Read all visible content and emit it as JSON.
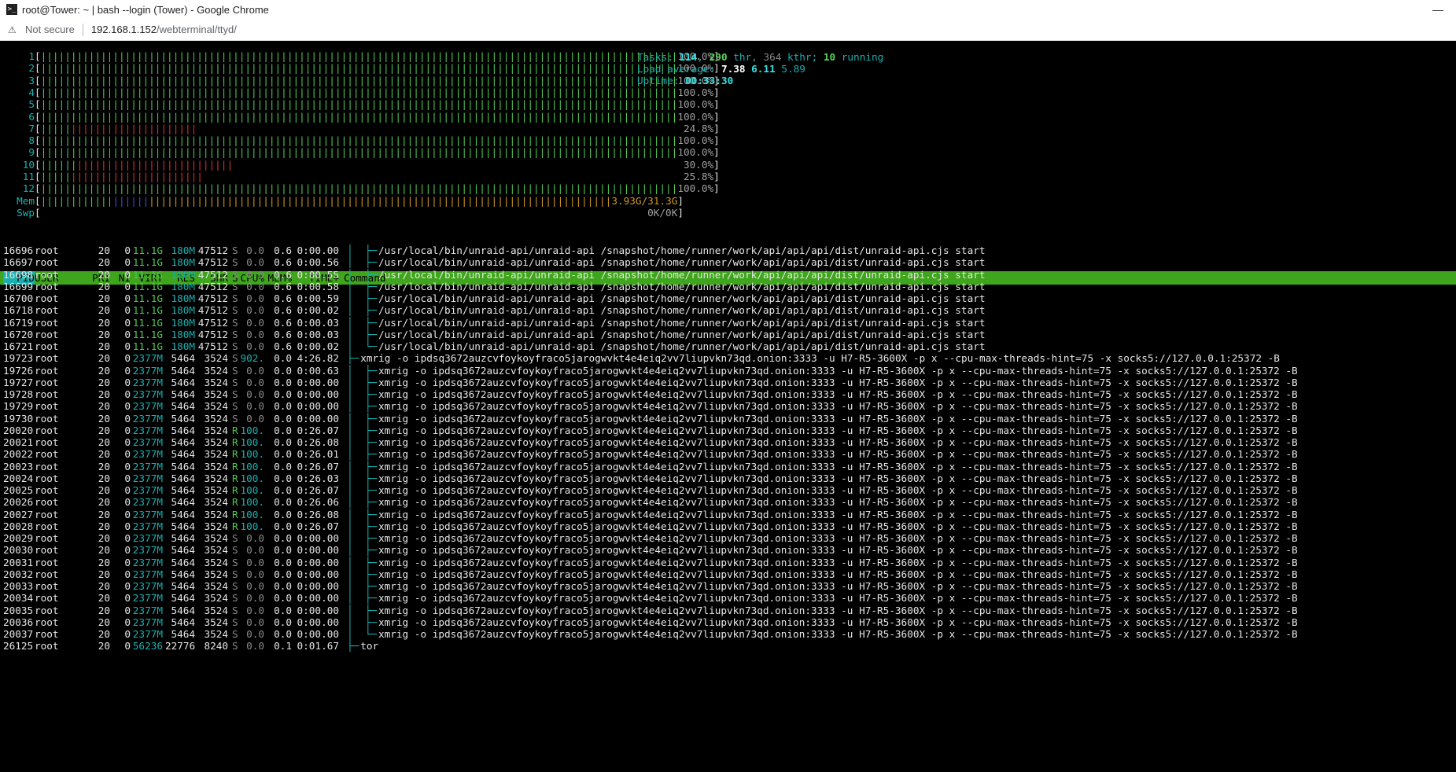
{
  "window": {
    "title": "root@Tower: ~ | bash --login (Tower) - Google Chrome",
    "minimize": "—"
  },
  "address": {
    "security": "Not secure",
    "host": "192.168.1.152",
    "path": "/webterminal/ttyd/"
  },
  "meters": {
    "cpus": [
      {
        "label": "1",
        "value": "100.0%",
        "level": 1.0,
        "red": false
      },
      {
        "label": "2",
        "value": "100.0%",
        "level": 1.0,
        "red": false
      },
      {
        "label": "3",
        "value": "100.0%",
        "level": 1.0,
        "red": false
      },
      {
        "label": "4",
        "value": "100.0%",
        "level": 1.0,
        "red": false
      },
      {
        "label": "5",
        "value": "100.0%",
        "level": 1.0,
        "red": false
      },
      {
        "label": "6",
        "value": "100.0%",
        "level": 1.0,
        "red": false
      },
      {
        "label": "7",
        "value": "24.8%",
        "level": 0.248,
        "red": true
      },
      {
        "label": "8",
        "value": "100.0%",
        "level": 1.0,
        "red": false
      },
      {
        "label": "9",
        "value": "100.0%",
        "level": 1.0,
        "red": false
      },
      {
        "label": "10",
        "value": "30.0%",
        "level": 0.3,
        "red": true
      },
      {
        "label": "11",
        "value": "25.8%",
        "level": 0.258,
        "red": true
      },
      {
        "label": "12",
        "value": "100.0%",
        "level": 1.0,
        "red": false
      }
    ],
    "mem": {
      "label": "Mem",
      "value": "3.93G/31.3G"
    },
    "swp": {
      "label": "Swp",
      "value": "0K/0K"
    }
  },
  "summary": {
    "tasks_label": "Tasks:",
    "tasks": "114",
    "thr": "290",
    "thr_label": "thr,",
    "kthr": "364",
    "kthr_label": "kthr;",
    "running": "10",
    "running_label": "running",
    "load_label": "Load average:",
    "load1": "7.38",
    "load5": "6.11",
    "load15": "5.89",
    "uptime_label": "Uptime:",
    "uptime": "00:33:30"
  },
  "columns": [
    "PID",
    "USER",
    "PRI",
    "NI",
    "VIRT",
    "RES",
    "SHR",
    "S",
    "CPU%",
    "MEM%",
    "TIME+",
    "Command"
  ],
  "processes": [
    {
      "pid": "16696",
      "user": "root",
      "pri": "20",
      "ni": "0",
      "virt": "11.1G",
      "res": "180M",
      "shr": "47512",
      "s": "S",
      "cpu": "0.0",
      "mem": "0.6",
      "time": "0:00.00",
      "tree": "│  ├─",
      "cmd": "/usr/local/bin/unraid-api/unraid-api /snapshot/home/runner/work/api/api/api/dist/unraid-api.cjs start"
    },
    {
      "pid": "16697",
      "user": "root",
      "pri": "20",
      "ni": "0",
      "virt": "11.1G",
      "res": "180M",
      "shr": "47512",
      "s": "S",
      "cpu": "0.0",
      "mem": "0.6",
      "time": "0:00.56",
      "tree": "│  ├─",
      "cmd": "/usr/local/bin/unraid-api/unraid-api /snapshot/home/runner/work/api/api/api/dist/unraid-api.cjs start"
    },
    {
      "pid": "16698",
      "user": "root",
      "pri": "20",
      "ni": "0",
      "virt": "11.1G",
      "res": "180M",
      "shr": "47512",
      "s": "S",
      "cpu": "0.0",
      "mem": "0.6",
      "time": "0:00.55",
      "tree": "│  ├─",
      "cmd": "/usr/local/bin/unraid-api/unraid-api /snapshot/home/runner/work/api/api/api/dist/unraid-api.cjs start"
    },
    {
      "pid": "16699",
      "user": "root",
      "pri": "20",
      "ni": "0",
      "virt": "11.1G",
      "res": "180M",
      "shr": "47512",
      "s": "S",
      "cpu": "0.0",
      "mem": "0.6",
      "time": "0:00.58",
      "tree": "│  ├─",
      "cmd": "/usr/local/bin/unraid-api/unraid-api /snapshot/home/runner/work/api/api/api/dist/unraid-api.cjs start"
    },
    {
      "pid": "16700",
      "user": "root",
      "pri": "20",
      "ni": "0",
      "virt": "11.1G",
      "res": "180M",
      "shr": "47512",
      "s": "S",
      "cpu": "0.0",
      "mem": "0.6",
      "time": "0:00.59",
      "tree": "│  ├─",
      "cmd": "/usr/local/bin/unraid-api/unraid-api /snapshot/home/runner/work/api/api/api/dist/unraid-api.cjs start"
    },
    {
      "pid": "16718",
      "user": "root",
      "pri": "20",
      "ni": "0",
      "virt": "11.1G",
      "res": "180M",
      "shr": "47512",
      "s": "S",
      "cpu": "0.0",
      "mem": "0.6",
      "time": "0:00.02",
      "tree": "│  ├─",
      "cmd": "/usr/local/bin/unraid-api/unraid-api /snapshot/home/runner/work/api/api/api/dist/unraid-api.cjs start"
    },
    {
      "pid": "16719",
      "user": "root",
      "pri": "20",
      "ni": "0",
      "virt": "11.1G",
      "res": "180M",
      "shr": "47512",
      "s": "S",
      "cpu": "0.0",
      "mem": "0.6",
      "time": "0:00.03",
      "tree": "│  ├─",
      "cmd": "/usr/local/bin/unraid-api/unraid-api /snapshot/home/runner/work/api/api/api/dist/unraid-api.cjs start"
    },
    {
      "pid": "16720",
      "user": "root",
      "pri": "20",
      "ni": "0",
      "virt": "11.1G",
      "res": "180M",
      "shr": "47512",
      "s": "S",
      "cpu": "0.0",
      "mem": "0.6",
      "time": "0:00.03",
      "tree": "│  ├─",
      "cmd": "/usr/local/bin/unraid-api/unraid-api /snapshot/home/runner/work/api/api/api/dist/unraid-api.cjs start"
    },
    {
      "pid": "16721",
      "user": "root",
      "pri": "20",
      "ni": "0",
      "virt": "11.1G",
      "res": "180M",
      "shr": "47512",
      "s": "S",
      "cpu": "0.0",
      "mem": "0.6",
      "time": "0:00.02",
      "tree": "│  └─",
      "cmd": "/usr/local/bin/unraid-api/unraid-api /snapshot/home/runner/work/api/api/api/dist/unraid-api.cjs start"
    },
    {
      "pid": "19723",
      "user": "root",
      "pri": "20",
      "ni": "0",
      "virt": "2377M",
      "res": "5464",
      "shr": "3524",
      "s": "S",
      "cpu": "902.",
      "mem": "0.0",
      "time": "4:26.82",
      "tree": "├─",
      "cmd": "xmrig -o ipdsq3672auzcvfoykoyfraco5jarogwvkt4e4eiq2vv7liupvkn73qd.onion:3333 -u H7-R5-3600X -p x --cpu-max-threads-hint=75 -x socks5://127.0.0.1:25372 -B"
    },
    {
      "pid": "19726",
      "user": "root",
      "pri": "20",
      "ni": "0",
      "virt": "2377M",
      "res": "5464",
      "shr": "3524",
      "s": "S",
      "cpu": "0.0",
      "mem": "0.0",
      "time": "0:00.63",
      "tree": "│  ├─",
      "cmd": "xmrig -o ipdsq3672auzcvfoykoyfraco5jarogwvkt4e4eiq2vv7liupvkn73qd.onion:3333 -u H7-R5-3600X -p x --cpu-max-threads-hint=75 -x socks5://127.0.0.1:25372 -B"
    },
    {
      "pid": "19727",
      "user": "root",
      "pri": "20",
      "ni": "0",
      "virt": "2377M",
      "res": "5464",
      "shr": "3524",
      "s": "S",
      "cpu": "0.0",
      "mem": "0.0",
      "time": "0:00.00",
      "tree": "│  ├─",
      "cmd": "xmrig -o ipdsq3672auzcvfoykoyfraco5jarogwvkt4e4eiq2vv7liupvkn73qd.onion:3333 -u H7-R5-3600X -p x --cpu-max-threads-hint=75 -x socks5://127.0.0.1:25372 -B"
    },
    {
      "pid": "19728",
      "user": "root",
      "pri": "20",
      "ni": "0",
      "virt": "2377M",
      "res": "5464",
      "shr": "3524",
      "s": "S",
      "cpu": "0.0",
      "mem": "0.0",
      "time": "0:00.00",
      "tree": "│  ├─",
      "cmd": "xmrig -o ipdsq3672auzcvfoykoyfraco5jarogwvkt4e4eiq2vv7liupvkn73qd.onion:3333 -u H7-R5-3600X -p x --cpu-max-threads-hint=75 -x socks5://127.0.0.1:25372 -B"
    },
    {
      "pid": "19729",
      "user": "root",
      "pri": "20",
      "ni": "0",
      "virt": "2377M",
      "res": "5464",
      "shr": "3524",
      "s": "S",
      "cpu": "0.0",
      "mem": "0.0",
      "time": "0:00.00",
      "tree": "│  ├─",
      "cmd": "xmrig -o ipdsq3672auzcvfoykoyfraco5jarogwvkt4e4eiq2vv7liupvkn73qd.onion:3333 -u H7-R5-3600X -p x --cpu-max-threads-hint=75 -x socks5://127.0.0.1:25372 -B"
    },
    {
      "pid": "19730",
      "user": "root",
      "pri": "20",
      "ni": "0",
      "virt": "2377M",
      "res": "5464",
      "shr": "3524",
      "s": "S",
      "cpu": "0.0",
      "mem": "0.0",
      "time": "0:00.00",
      "tree": "│  ├─",
      "cmd": "xmrig -o ipdsq3672auzcvfoykoyfraco5jarogwvkt4e4eiq2vv7liupvkn73qd.onion:3333 -u H7-R5-3600X -p x --cpu-max-threads-hint=75 -x socks5://127.0.0.1:25372 -B"
    },
    {
      "pid": "20020",
      "user": "root",
      "pri": "20",
      "ni": "0",
      "virt": "2377M",
      "res": "5464",
      "shr": "3524",
      "s": "R",
      "cpu": "100.",
      "mem": "0.0",
      "time": "0:26.07",
      "tree": "│  ├─",
      "cmd": "xmrig -o ipdsq3672auzcvfoykoyfraco5jarogwvkt4e4eiq2vv7liupvkn73qd.onion:3333 -u H7-R5-3600X -p x --cpu-max-threads-hint=75 -x socks5://127.0.0.1:25372 -B"
    },
    {
      "pid": "20021",
      "user": "root",
      "pri": "20",
      "ni": "0",
      "virt": "2377M",
      "res": "5464",
      "shr": "3524",
      "s": "R",
      "cpu": "100.",
      "mem": "0.0",
      "time": "0:26.08",
      "tree": "│  ├─",
      "cmd": "xmrig -o ipdsq3672auzcvfoykoyfraco5jarogwvkt4e4eiq2vv7liupvkn73qd.onion:3333 -u H7-R5-3600X -p x --cpu-max-threads-hint=75 -x socks5://127.0.0.1:25372 -B"
    },
    {
      "pid": "20022",
      "user": "root",
      "pri": "20",
      "ni": "0",
      "virt": "2377M",
      "res": "5464",
      "shr": "3524",
      "s": "R",
      "cpu": "100.",
      "mem": "0.0",
      "time": "0:26.01",
      "tree": "│  ├─",
      "cmd": "xmrig -o ipdsq3672auzcvfoykoyfraco5jarogwvkt4e4eiq2vv7liupvkn73qd.onion:3333 -u H7-R5-3600X -p x --cpu-max-threads-hint=75 -x socks5://127.0.0.1:25372 -B"
    },
    {
      "pid": "20023",
      "user": "root",
      "pri": "20",
      "ni": "0",
      "virt": "2377M",
      "res": "5464",
      "shr": "3524",
      "s": "R",
      "cpu": "100.",
      "mem": "0.0",
      "time": "0:26.07",
      "tree": "│  ├─",
      "cmd": "xmrig -o ipdsq3672auzcvfoykoyfraco5jarogwvkt4e4eiq2vv7liupvkn73qd.onion:3333 -u H7-R5-3600X -p x --cpu-max-threads-hint=75 -x socks5://127.0.0.1:25372 -B"
    },
    {
      "pid": "20024",
      "user": "root",
      "pri": "20",
      "ni": "0",
      "virt": "2377M",
      "res": "5464",
      "shr": "3524",
      "s": "R",
      "cpu": "100.",
      "mem": "0.0",
      "time": "0:26.03",
      "tree": "│  ├─",
      "cmd": "xmrig -o ipdsq3672auzcvfoykoyfraco5jarogwvkt4e4eiq2vv7liupvkn73qd.onion:3333 -u H7-R5-3600X -p x --cpu-max-threads-hint=75 -x socks5://127.0.0.1:25372 -B"
    },
    {
      "pid": "20025",
      "user": "root",
      "pri": "20",
      "ni": "0",
      "virt": "2377M",
      "res": "5464",
      "shr": "3524",
      "s": "R",
      "cpu": "100.",
      "mem": "0.0",
      "time": "0:26.07",
      "tree": "│  ├─",
      "cmd": "xmrig -o ipdsq3672auzcvfoykoyfraco5jarogwvkt4e4eiq2vv7liupvkn73qd.onion:3333 -u H7-R5-3600X -p x --cpu-max-threads-hint=75 -x socks5://127.0.0.1:25372 -B"
    },
    {
      "pid": "20026",
      "user": "root",
      "pri": "20",
      "ni": "0",
      "virt": "2377M",
      "res": "5464",
      "shr": "3524",
      "s": "R",
      "cpu": "100.",
      "mem": "0.0",
      "time": "0:26.06",
      "tree": "│  ├─",
      "cmd": "xmrig -o ipdsq3672auzcvfoykoyfraco5jarogwvkt4e4eiq2vv7liupvkn73qd.onion:3333 -u H7-R5-3600X -p x --cpu-max-threads-hint=75 -x socks5://127.0.0.1:25372 -B"
    },
    {
      "pid": "20027",
      "user": "root",
      "pri": "20",
      "ni": "0",
      "virt": "2377M",
      "res": "5464",
      "shr": "3524",
      "s": "R",
      "cpu": "100.",
      "mem": "0.0",
      "time": "0:26.08",
      "tree": "│  ├─",
      "cmd": "xmrig -o ipdsq3672auzcvfoykoyfraco5jarogwvkt4e4eiq2vv7liupvkn73qd.onion:3333 -u H7-R5-3600X -p x --cpu-max-threads-hint=75 -x socks5://127.0.0.1:25372 -B"
    },
    {
      "pid": "20028",
      "user": "root",
      "pri": "20",
      "ni": "0",
      "virt": "2377M",
      "res": "5464",
      "shr": "3524",
      "s": "R",
      "cpu": "100.",
      "mem": "0.0",
      "time": "0:26.07",
      "tree": "│  ├─",
      "cmd": "xmrig -o ipdsq3672auzcvfoykoyfraco5jarogwvkt4e4eiq2vv7liupvkn73qd.onion:3333 -u H7-R5-3600X -p x --cpu-max-threads-hint=75 -x socks5://127.0.0.1:25372 -B"
    },
    {
      "pid": "20029",
      "user": "root",
      "pri": "20",
      "ni": "0",
      "virt": "2377M",
      "res": "5464",
      "shr": "3524",
      "s": "S",
      "cpu": "0.0",
      "mem": "0.0",
      "time": "0:00.00",
      "tree": "│  ├─",
      "cmd": "xmrig -o ipdsq3672auzcvfoykoyfraco5jarogwvkt4e4eiq2vv7liupvkn73qd.onion:3333 -u H7-R5-3600X -p x --cpu-max-threads-hint=75 -x socks5://127.0.0.1:25372 -B"
    },
    {
      "pid": "20030",
      "user": "root",
      "pri": "20",
      "ni": "0",
      "virt": "2377M",
      "res": "5464",
      "shr": "3524",
      "s": "S",
      "cpu": "0.0",
      "mem": "0.0",
      "time": "0:00.00",
      "tree": "│  ├─",
      "cmd": "xmrig -o ipdsq3672auzcvfoykoyfraco5jarogwvkt4e4eiq2vv7liupvkn73qd.onion:3333 -u H7-R5-3600X -p x --cpu-max-threads-hint=75 -x socks5://127.0.0.1:25372 -B"
    },
    {
      "pid": "20031",
      "user": "root",
      "pri": "20",
      "ni": "0",
      "virt": "2377M",
      "res": "5464",
      "shr": "3524",
      "s": "S",
      "cpu": "0.0",
      "mem": "0.0",
      "time": "0:00.00",
      "tree": "│  ├─",
      "cmd": "xmrig -o ipdsq3672auzcvfoykoyfraco5jarogwvkt4e4eiq2vv7liupvkn73qd.onion:3333 -u H7-R5-3600X -p x --cpu-max-threads-hint=75 -x socks5://127.0.0.1:25372 -B"
    },
    {
      "pid": "20032",
      "user": "root",
      "pri": "20",
      "ni": "0",
      "virt": "2377M",
      "res": "5464",
      "shr": "3524",
      "s": "S",
      "cpu": "0.0",
      "mem": "0.0",
      "time": "0:00.00",
      "tree": "│  ├─",
      "cmd": "xmrig -o ipdsq3672auzcvfoykoyfraco5jarogwvkt4e4eiq2vv7liupvkn73qd.onion:3333 -u H7-R5-3600X -p x --cpu-max-threads-hint=75 -x socks5://127.0.0.1:25372 -B"
    },
    {
      "pid": "20033",
      "user": "root",
      "pri": "20",
      "ni": "0",
      "virt": "2377M",
      "res": "5464",
      "shr": "3524",
      "s": "S",
      "cpu": "0.0",
      "mem": "0.0",
      "time": "0:00.00",
      "tree": "│  ├─",
      "cmd": "xmrig -o ipdsq3672auzcvfoykoyfraco5jarogwvkt4e4eiq2vv7liupvkn73qd.onion:3333 -u H7-R5-3600X -p x --cpu-max-threads-hint=75 -x socks5://127.0.0.1:25372 -B"
    },
    {
      "pid": "20034",
      "user": "root",
      "pri": "20",
      "ni": "0",
      "virt": "2377M",
      "res": "5464",
      "shr": "3524",
      "s": "S",
      "cpu": "0.0",
      "mem": "0.0",
      "time": "0:00.00",
      "tree": "│  ├─",
      "cmd": "xmrig -o ipdsq3672auzcvfoykoyfraco5jarogwvkt4e4eiq2vv7liupvkn73qd.onion:3333 -u H7-R5-3600X -p x --cpu-max-threads-hint=75 -x socks5://127.0.0.1:25372 -B"
    },
    {
      "pid": "20035",
      "user": "root",
      "pri": "20",
      "ni": "0",
      "virt": "2377M",
      "res": "5464",
      "shr": "3524",
      "s": "S",
      "cpu": "0.0",
      "mem": "0.0",
      "time": "0:00.00",
      "tree": "│  ├─",
      "cmd": "xmrig -o ipdsq3672auzcvfoykoyfraco5jarogwvkt4e4eiq2vv7liupvkn73qd.onion:3333 -u H7-R5-3600X -p x --cpu-max-threads-hint=75 -x socks5://127.0.0.1:25372 -B"
    },
    {
      "pid": "20036",
      "user": "root",
      "pri": "20",
      "ni": "0",
      "virt": "2377M",
      "res": "5464",
      "shr": "3524",
      "s": "S",
      "cpu": "0.0",
      "mem": "0.0",
      "time": "0:00.00",
      "tree": "│  ├─",
      "cmd": "xmrig -o ipdsq3672auzcvfoykoyfraco5jarogwvkt4e4eiq2vv7liupvkn73qd.onion:3333 -u H7-R5-3600X -p x --cpu-max-threads-hint=75 -x socks5://127.0.0.1:25372 -B"
    },
    {
      "pid": "20037",
      "user": "root",
      "pri": "20",
      "ni": "0",
      "virt": "2377M",
      "res": "5464",
      "shr": "3524",
      "s": "S",
      "cpu": "0.0",
      "mem": "0.0",
      "time": "0:00.00",
      "tree": "│  └─",
      "cmd": "xmrig -o ipdsq3672auzcvfoykoyfraco5jarogwvkt4e4eiq2vv7liupvkn73qd.onion:3333 -u H7-R5-3600X -p x --cpu-max-threads-hint=75 -x socks5://127.0.0.1:25372 -B"
    },
    {
      "pid": "26125",
      "user": "root",
      "pri": "20",
      "ni": "0",
      "virt": "56236",
      "res": "22776",
      "shr": "8240",
      "s": "S",
      "cpu": "0.0",
      "mem": "0.1",
      "time": "0:01.67",
      "tree": "├─",
      "cmd": "tor"
    }
  ]
}
